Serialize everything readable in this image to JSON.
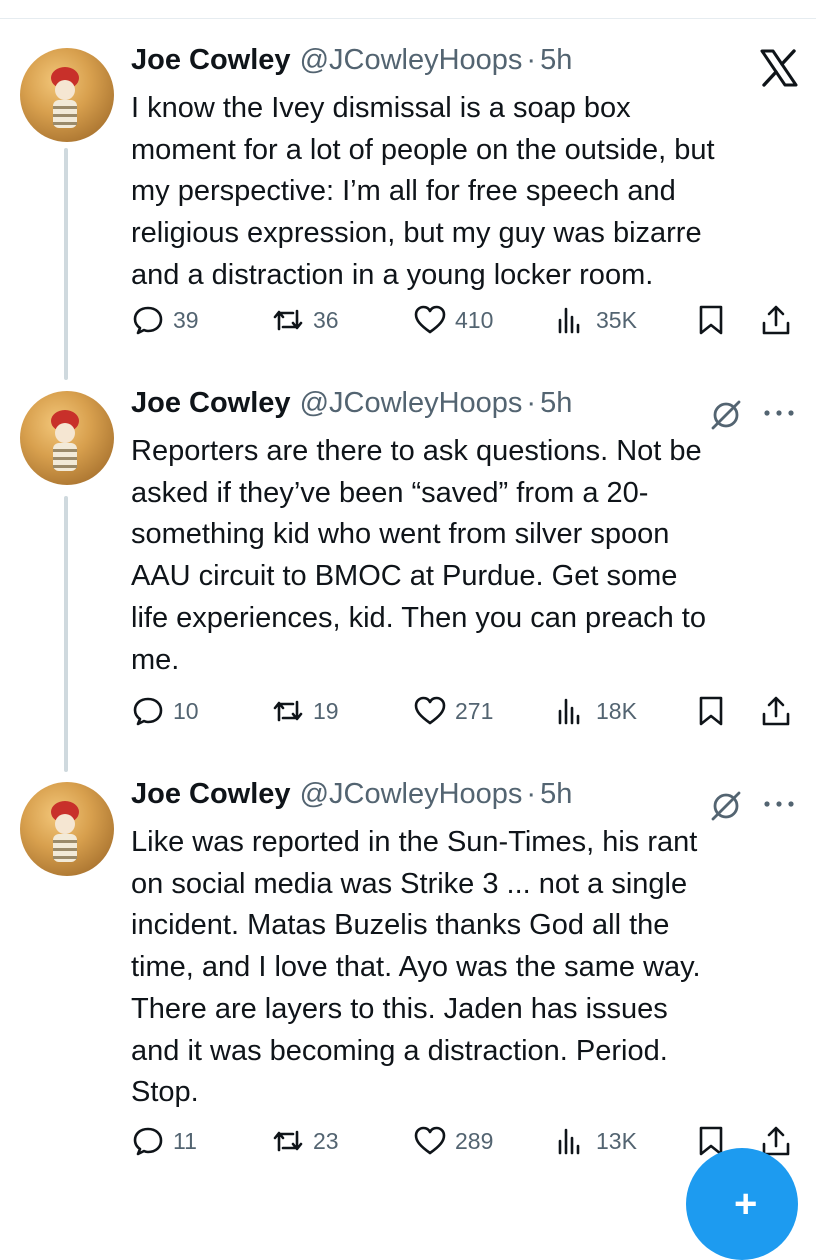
{
  "tweets": [
    {
      "author": {
        "name": "Joe Cowley",
        "handle": "@JCowleyHoops"
      },
      "time": "5h",
      "text": "I know the Ivey dismissal is a soap box\nmoment for a lot of people on the outside, but\nmy perspective: I’m all for free speech and\nreligious expression, but my guy was bizarre\nand a distraction in a young locker room.",
      "replies": "39",
      "reposts": "36",
      "likes": "410",
      "views": "35K"
    },
    {
      "author": {
        "name": "Joe Cowley",
        "handle": "@JCowleyHoops"
      },
      "time": "5h",
      "text": "Reporters are there to ask questions. Not be\nasked if they’ve been “saved” from a 20-\nsomething kid who went from silver spoon\nAAU circuit to BMOC at Purdue. Get some\nlife experiences, kid. Then you can preach to\nme.",
      "replies": "10",
      "reposts": "19",
      "likes": "271",
      "views": "18K"
    },
    {
      "author": {
        "name": "Joe Cowley",
        "handle": "@JCowleyHoops"
      },
      "time": "5h",
      "text": "Like was reported in the Sun-Times, his rant\non social media was Strike 3 ... not a single\nincident. Matas Buzelis thanks God all the\ntime, and I love that. Ayo was the same way.\nThere are layers to this. Jaden has issues\nand it was becoming a distraction. Period.\nStop.",
      "replies": "11",
      "reposts": "23",
      "likes": "289",
      "views": "13K"
    }
  ],
  "separator": "·",
  "fab": {
    "label": "+"
  },
  "icons": {
    "reply": "reply-icon",
    "repost": "repost-icon",
    "like": "heart-icon",
    "views": "views-icon",
    "bookmark": "bookmark-icon",
    "share": "share-icon",
    "brand": "x-logo-icon",
    "grok": "grok-icon",
    "more": "more-icon"
  },
  "colors": {
    "text": "#0f1419",
    "secondary": "#536471",
    "thread_line": "#cfd9de",
    "accent": "#1d9bf0"
  }
}
